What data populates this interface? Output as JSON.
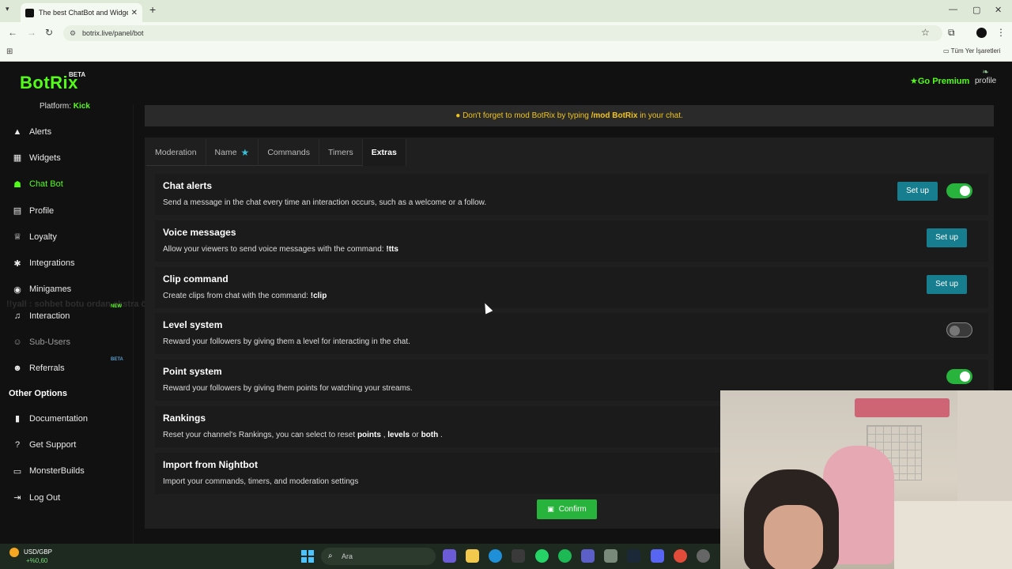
{
  "browser": {
    "tab_title": "The best ChatBot and Widgets",
    "url": "botrix.live/panel/bot",
    "bookmarks_label": "Tüm Yer İşaretleri"
  },
  "app": {
    "brand": "BotRix",
    "brand_badge": "BETA",
    "premium_label": "Go Premium",
    "profile_label": "profile",
    "platform_label": "Platform:",
    "platform_value": "Kick"
  },
  "sidebar": {
    "items": [
      {
        "label": "Alerts",
        "icon": "warning-icon"
      },
      {
        "label": "Widgets",
        "icon": "grid-icon"
      },
      {
        "label": "Chat Bot",
        "icon": "robot-icon"
      },
      {
        "label": "Profile",
        "icon": "id-card-icon"
      },
      {
        "label": "Loyalty",
        "icon": "trophy-icon"
      },
      {
        "label": "Integrations",
        "icon": "puzzle-icon"
      },
      {
        "label": "Minigames",
        "icon": "gamepad-icon"
      },
      {
        "label": "Interaction",
        "icon": "music-icon",
        "badge": "NEW"
      },
      {
        "label": "Sub-Users",
        "icon": "users-icon"
      },
      {
        "label": "Referrals",
        "icon": "people-icon",
        "badge": "BETA"
      }
    ],
    "other_title": "Other Options",
    "other_items": [
      {
        "label": "Documentation",
        "icon": "book-icon"
      },
      {
        "label": "Get Support",
        "icon": "question-icon"
      },
      {
        "label": "MonsterBuilds",
        "icon": "laptop-icon"
      },
      {
        "label": "Log Out",
        "icon": "logout-icon"
      }
    ]
  },
  "overlay_caption": "!!yall : sohbet botu ordan ekstra özellikler",
  "notice": {
    "prefix": "Don't forget to mod BotRix by typing",
    "command": "/mod BotRix",
    "suffix": "in your chat."
  },
  "tabs": [
    "Moderation",
    "Name",
    "Commands",
    "Timers",
    "Extras"
  ],
  "active_tab": "Extras",
  "rows": [
    {
      "title": "Chat alerts",
      "desc": "Send a message in the chat every time an interaction occurs, such as a welcome or a follow.",
      "button": "Set up",
      "toggle": "on"
    },
    {
      "title": "Voice messages",
      "desc": "Allow your viewers to send voice messages with the command:",
      "desc_bold": "!tts",
      "button": "Set up"
    },
    {
      "title": "Clip command",
      "desc": "Create clips from chat with the command:",
      "desc_bold": "!clip",
      "button": "Set up"
    },
    {
      "title": "Level system",
      "desc": "Reward your followers by giving them a level for interacting in the chat.",
      "toggle": "off"
    },
    {
      "title": "Point system",
      "desc": "Reward your followers by giving them points for watching your streams.",
      "toggle": "on"
    },
    {
      "title": "Rankings",
      "desc": "Reset your channel's Rankings, you can select to reset",
      "b1": "points",
      "sep1": ",",
      "b2": "levels",
      "sep2": "or",
      "b3": "both",
      "end": "."
    },
    {
      "title": "Import from Nightbot",
      "desc": "Import your commands, timers, and moderation settings"
    }
  ],
  "confirm_label": "Confirm",
  "taskbar": {
    "weather_label": "USD/GBP",
    "weather_change": "+%0,60",
    "search_placeholder": "Ara"
  },
  "colors": {
    "brand": "#53fc18",
    "setup_button": "#177e8f",
    "toggle_on": "#28b43c",
    "notice_text": "#f0c419"
  }
}
